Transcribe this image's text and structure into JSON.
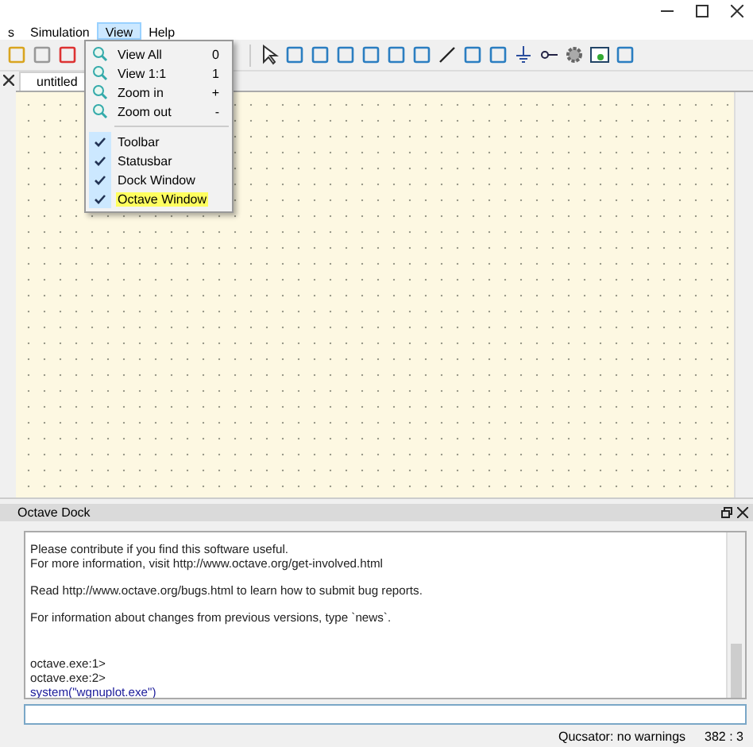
{
  "menu_bar": [
    {
      "label": "s",
      "selected": false
    },
    {
      "label": "Simulation",
      "selected": false
    },
    {
      "label": "View",
      "selected": true
    },
    {
      "label": "Help",
      "selected": false
    }
  ],
  "view_menu": {
    "items": [
      {
        "kind": "zoom",
        "label": "View All",
        "shortcut": "0",
        "checked": false,
        "selected": false
      },
      {
        "kind": "zoom",
        "label": "View 1:1",
        "shortcut": "1",
        "checked": false,
        "selected": false
      },
      {
        "kind": "zoom",
        "label": "Zoom in",
        "shortcut": "+",
        "checked": false,
        "selected": false
      },
      {
        "kind": "zoom",
        "label": "Zoom out",
        "shortcut": "-",
        "checked": false,
        "selected": false
      },
      {
        "kind": "separator"
      },
      {
        "kind": "toggle",
        "label": "Toolbar",
        "checked": true,
        "selected": false
      },
      {
        "kind": "toggle",
        "label": "Statusbar",
        "checked": true,
        "selected": false
      },
      {
        "kind": "toggle",
        "label": "Dock Window",
        "checked": true,
        "selected": false
      },
      {
        "kind": "toggle",
        "label": "Octave Window",
        "checked": true,
        "selected": true
      }
    ]
  },
  "tabs": [
    {
      "label": "untitled",
      "selected": true
    }
  ],
  "octave_dock": {
    "title": "Octave Dock",
    "paragraphs": [
      {
        "lines": [
          {
            "kind": "output",
            "text": "Please contribute if you find this software useful."
          },
          {
            "kind": "output",
            "text": "For more information, visit http://www.octave.org/get-involved.html"
          }
        ]
      },
      {
        "lines": [
          {
            "kind": "output",
            "text": "Read http://www.octave.org/bugs.html to learn how to submit bug reports."
          }
        ]
      },
      {
        "lines": [
          {
            "kind": "output",
            "text": "For information about changes from previous versions, type `news`."
          }
        ]
      },
      {
        "lines": [
          {
            "kind": "output",
            "text": "octave.exe:1>"
          },
          {
            "kind": "output",
            "text": "octave.exe:2>"
          },
          {
            "kind": "command",
            "text": "system(\"wgnuplot.exe\")"
          }
        ]
      }
    ]
  },
  "status_bar": {
    "message": "Qucsator: no warnings",
    "position": "382 : 3"
  }
}
